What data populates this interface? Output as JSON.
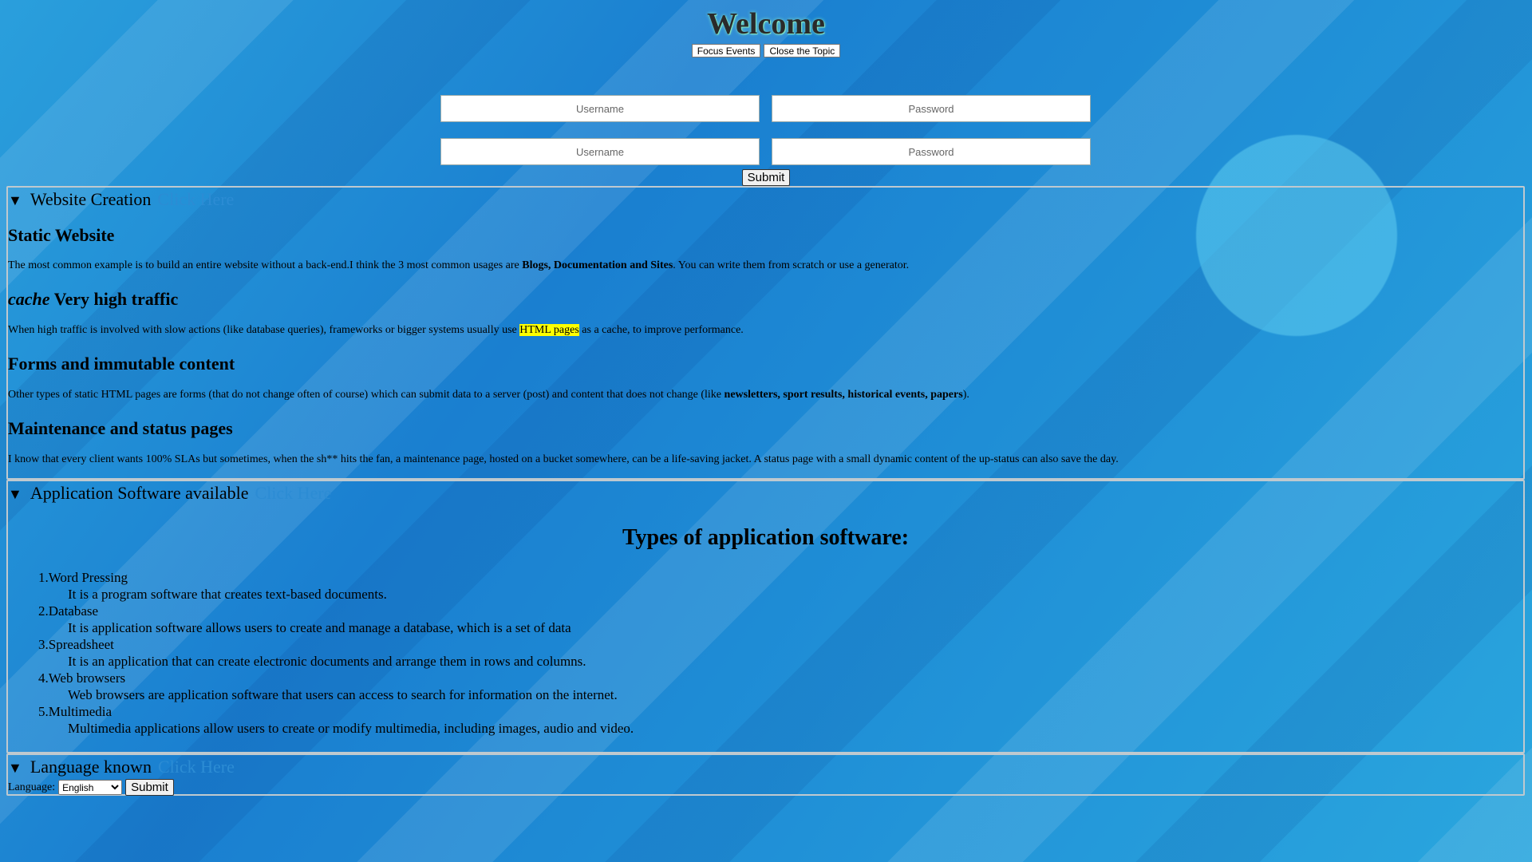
{
  "header": {
    "title": "Welcome",
    "focus_events_label": "Focus Events",
    "close_topic_label": "Close the Topic"
  },
  "login": {
    "username_placeholder": "Username",
    "password_placeholder": "Password",
    "submit_label": "Submit"
  },
  "website_creation": {
    "summary": "Website Creation",
    "click_here": "Click Here",
    "static_heading": "Static Website",
    "static_text_1": "The most common example is to build an entire website without a back-end.I think the 3 most common usages are ",
    "static_bold": "Blogs, Documentation and Sites",
    "static_text_2": ". You can write them from scratch or use a generator.",
    "traffic_italic": "cache",
    "traffic_heading": " Very high traffic",
    "traffic_text_1": "When high traffic is involved with slow actions (like database queries), frameworks or bigger systems usually use ",
    "traffic_highlight": "HTML pages",
    "traffic_text_2": " as a cache, to improve performance.",
    "forms_heading": "Forms and immutable content",
    "forms_text_1": "Other types of static HTML pages are forms (that do not change often of course) which can submit data to a server (post) and content that does not change (like ",
    "forms_bold": "newsletters, sport results, historical events, papers",
    "forms_text_2": ").",
    "maint_heading": "Maintenance and status pages",
    "maint_text": "I know that every client wants 100% SLAs but sometimes, when the sh** hits the fan, a maintenance page, hosted on a bucket somewhere, can be a life-saving jacket. A status page with a small dynamic content of the up-status can also save the day."
  },
  "app_software": {
    "summary": "Application Software available",
    "click_here": "Click Here",
    "heading": "Types of application software:",
    "items": [
      {
        "term": "1.Word Pressing",
        "desc": "It is a program software that creates text-based documents."
      },
      {
        "term": "2.Database",
        "desc": "It is application software allows users to create and manage a database, which is a set of data"
      },
      {
        "term": "3.Spreadsheet",
        "desc": "It is an application that can create electronic documents and arrange them in rows and columns."
      },
      {
        "term": "4.Web browsers",
        "desc": "Web browsers are application software that users can access to search for information on the internet."
      },
      {
        "term": "5.Multimedia",
        "desc": "Multimedia applications allow users to create or modify multimedia, including images, audio and video."
      }
    ]
  },
  "language": {
    "summary": "Language known",
    "click_here": "Click Here",
    "label": "Language:",
    "selected": "English",
    "submit_label": "Submit"
  },
  "colors": {
    "background": "#1f8ed6",
    "highlight": "#ffff00",
    "click_here": "#2c8cd4"
  }
}
